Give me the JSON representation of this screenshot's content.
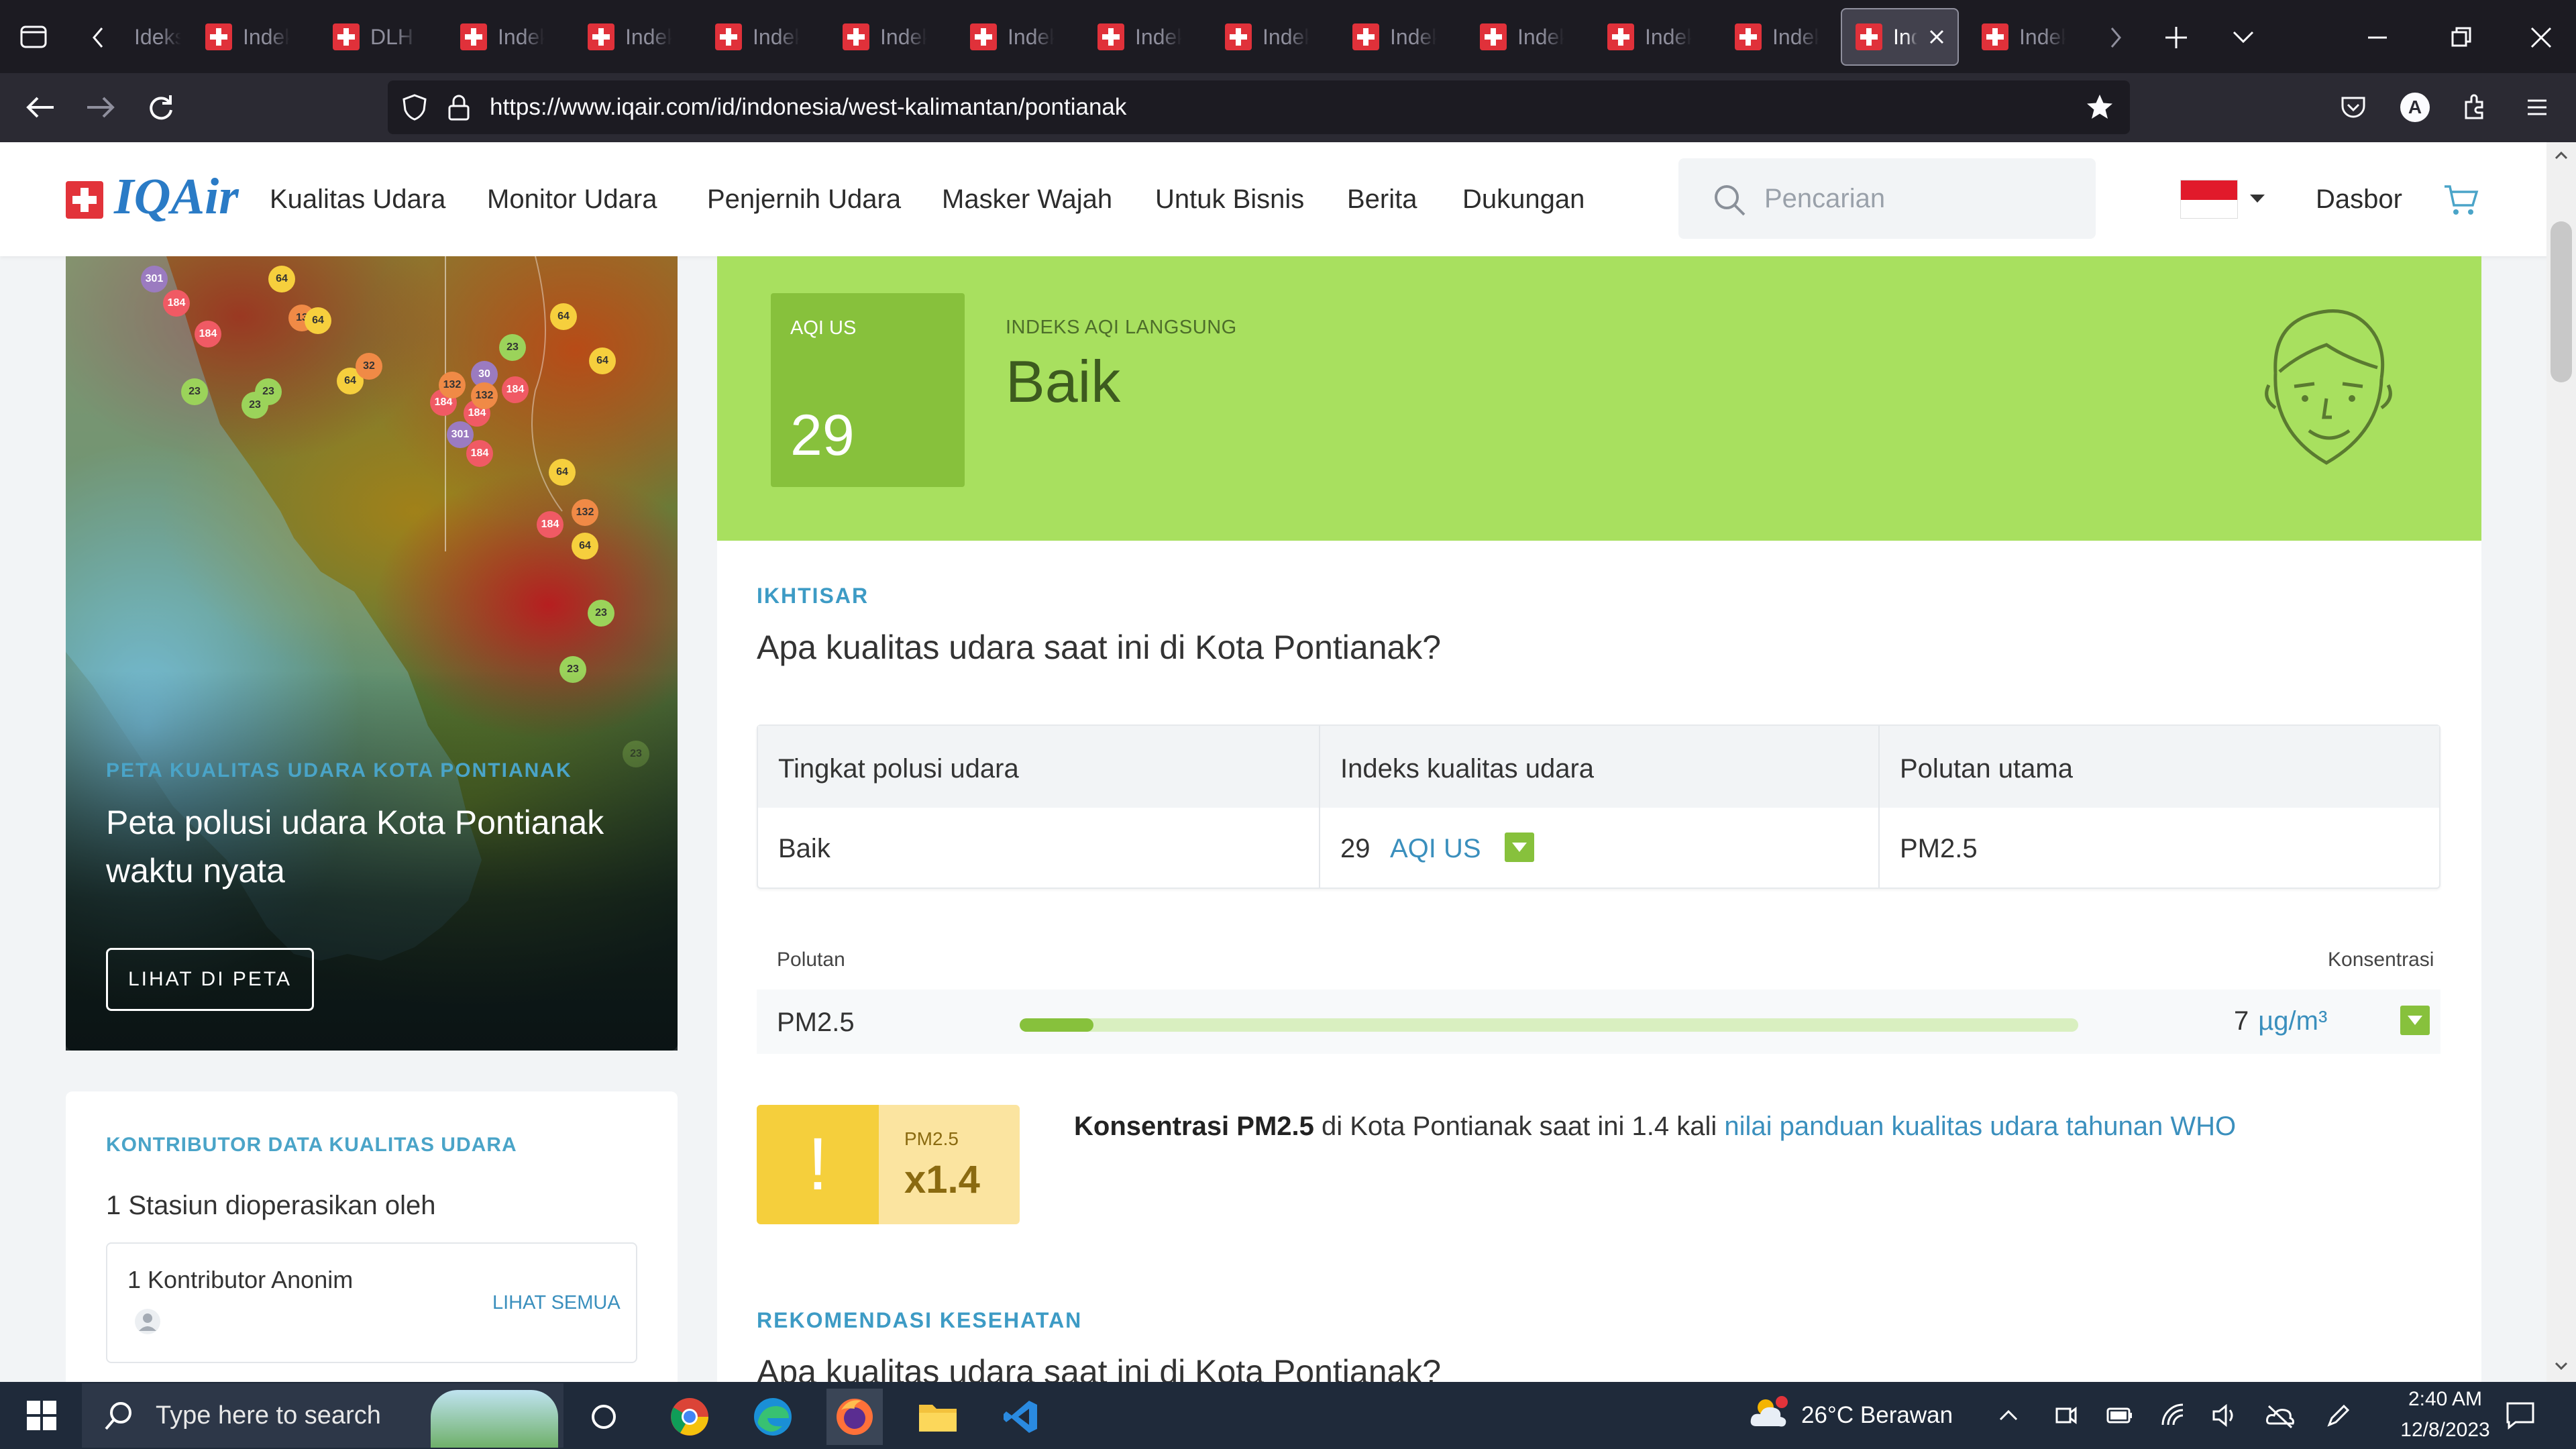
{
  "browser": {
    "tabs": [
      {
        "label": "Ideks"
      },
      {
        "label": "Indeks"
      },
      {
        "label": "DLH N"
      },
      {
        "label": "Indeks"
      },
      {
        "label": "Indeks"
      },
      {
        "label": "Indeks"
      },
      {
        "label": "Indeks"
      },
      {
        "label": "Indeks"
      },
      {
        "label": "Indeks"
      },
      {
        "label": "Indeks"
      },
      {
        "label": "Indeks"
      },
      {
        "label": "Indeks"
      },
      {
        "label": "Indeks"
      },
      {
        "label": "Indeks"
      },
      {
        "label": "Ind"
      },
      {
        "label": "Indeks"
      }
    ],
    "url": "https://www.iqair.com/id/indonesia/west-kalimantan/pontianak",
    "profile_initial": "A"
  },
  "header": {
    "logo": "IQAir",
    "nav": [
      "Kualitas Udara",
      "Monitor Udara",
      "Penjernih Udara",
      "Masker Wajah",
      "Untuk Bisnis",
      "Berita",
      "Dukungan"
    ],
    "search_placeholder": "Pencarian",
    "dashboard": "Dasbor"
  },
  "map": {
    "title": "PETA KUALITAS UDARA KOTA PONTIANAK",
    "desc": "Peta polusi udara Kota Pontianak waktu nyata",
    "button": "LIHAT DI PETA",
    "markers": [
      "301",
      "184",
      "184",
      "64",
      "13",
      "64",
      "23",
      "23",
      "23",
      "64",
      "32",
      "184",
      "132",
      "184",
      "30",
      "132",
      "184",
      "301",
      "184",
      "23",
      "64",
      "64",
      "64",
      "132",
      "184",
      "64",
      "23",
      "23",
      "23"
    ]
  },
  "contributors": {
    "title": "KONTRIBUTOR DATA KUALITAS UDARA",
    "subtitle": "1 Stasiun dioperasikan oleh",
    "name": "1 Kontributor Anonim",
    "see_all": "LIHAT SEMUA"
  },
  "aqi": {
    "label": "AQI US",
    "value": "29",
    "live_label": "INDEKS AQI LANGSUNG",
    "status": "Baik",
    "color": "#a8e05f"
  },
  "overview": {
    "heading": "IKHTISAR",
    "question": "Apa kualitas udara saat ini di Kota Pontianak?",
    "table": {
      "headers": [
        "Tingkat polusi udara",
        "Indeks kualitas udara",
        "Polutan utama"
      ],
      "level": "Baik",
      "index": "29",
      "index_unit": "AQI US",
      "main_pollutant": "PM2.5"
    },
    "pollutant_header": "Polutan",
    "concentration_header": "Konsentrasi",
    "pollutant": {
      "name": "PM2.5",
      "value": "7",
      "unit": "µg/m³",
      "bar_fraction": 0.07
    },
    "who": {
      "small": "PM2.5",
      "factor": "x1.4",
      "text_bold": "Konsentrasi PM2.5",
      "text": " di Kota Pontianak saat ini 1.4 kali ",
      "link": "nilai panduan kualitas udara tahunan WHO"
    }
  },
  "health": {
    "heading": "REKOMENDASI KESEHATAN",
    "question": "Apa kualitas udara saat ini di Kota Pontianak?"
  },
  "taskbar": {
    "search": "Type here to search",
    "weather": "26°C  Berawan",
    "time": "2:40 AM",
    "date": "12/8/2023"
  }
}
